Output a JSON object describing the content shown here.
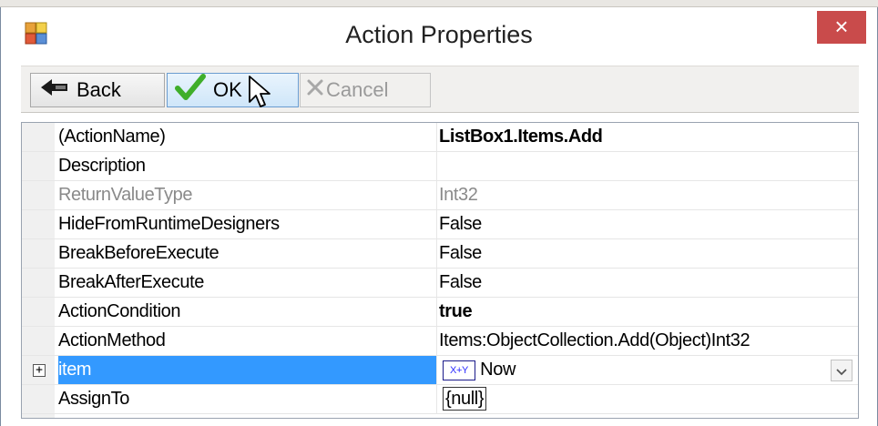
{
  "window": {
    "title": "Action Properties",
    "close_label": "×"
  },
  "toolbar": {
    "back_label": "Back",
    "ok_label": "OK",
    "cancel_label": "Cancel"
  },
  "grid": {
    "rows": [
      {
        "name": "(ActionName)",
        "value": "ListBox1.Items.Add"
      },
      {
        "name": "Description",
        "value": ""
      },
      {
        "name": "ReturnValueType",
        "value": "Int32"
      },
      {
        "name": "HideFromRuntimeDesigners",
        "value": "False"
      },
      {
        "name": "BreakBeforeExecute",
        "value": "False"
      },
      {
        "name": "BreakAfterExecute",
        "value": "False"
      },
      {
        "name": "ActionCondition",
        "value": "true"
      },
      {
        "name": "ActionMethod",
        "value": "Items:ObjectCollection.Add(Object)Int32"
      },
      {
        "name": "item",
        "value": "Now",
        "icon_text": "X+Y"
      },
      {
        "name": "AssignTo",
        "value": "{null}"
      }
    ]
  },
  "colors": {
    "selection": "#3399ff",
    "close_button": "#c94b4b",
    "ok_check": "#3fae2a"
  },
  "icons": {
    "app": "app-window-icon",
    "back": "back-arrow-icon",
    "ok": "checkmark-icon",
    "cancel": "x-cancel-icon",
    "cursor": "mouse-cursor-icon",
    "expander": "expand-plus-icon",
    "dropdown": "chevron-down-icon"
  }
}
